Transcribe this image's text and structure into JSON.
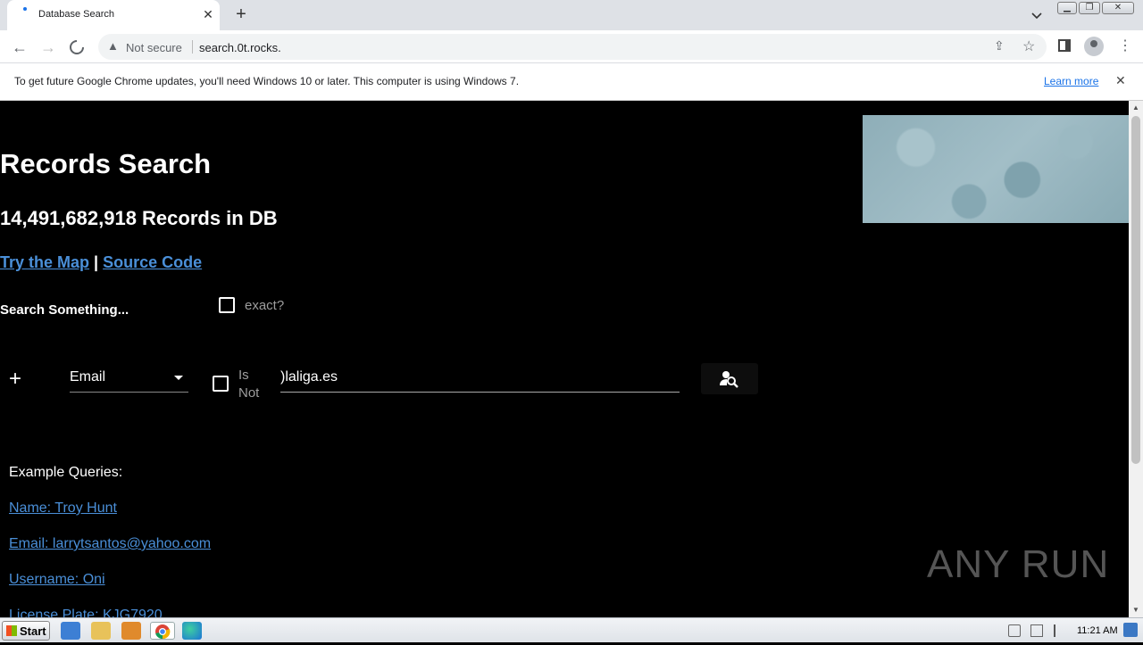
{
  "browser": {
    "tab_title": "Database Search",
    "not_secure": "Not secure",
    "url": "search.0t.rocks.",
    "info_text": "To get future Google Chrome updates, you'll need Windows 10 or later. This computer is using Windows 7.",
    "learn_more": "Learn more"
  },
  "page": {
    "title": "Records Search",
    "record_count": "14,491,682,918 Records in DB",
    "link_map": "Try the Map",
    "link_separator": "|",
    "link_source": "Source Code",
    "search_label": "Search Something...",
    "exact_label": "exact?",
    "field_select_value": "Email",
    "is_not_label": "Is Not",
    "search_value": ")laliga.es",
    "examples_title": "Example Queries:",
    "examples": [
      "Name: Troy Hunt",
      "Email: larrytsantos@yahoo.com",
      "Username: Oni",
      "License Plate: KJG7920"
    ]
  },
  "watermark": "ANY RUN",
  "taskbar": {
    "start_label": "Start",
    "clock": "11:21 AM"
  },
  "colors": {
    "link": "#4a8fd8",
    "page_bg": "#000000",
    "chrome_blue": "#1a73e8"
  }
}
